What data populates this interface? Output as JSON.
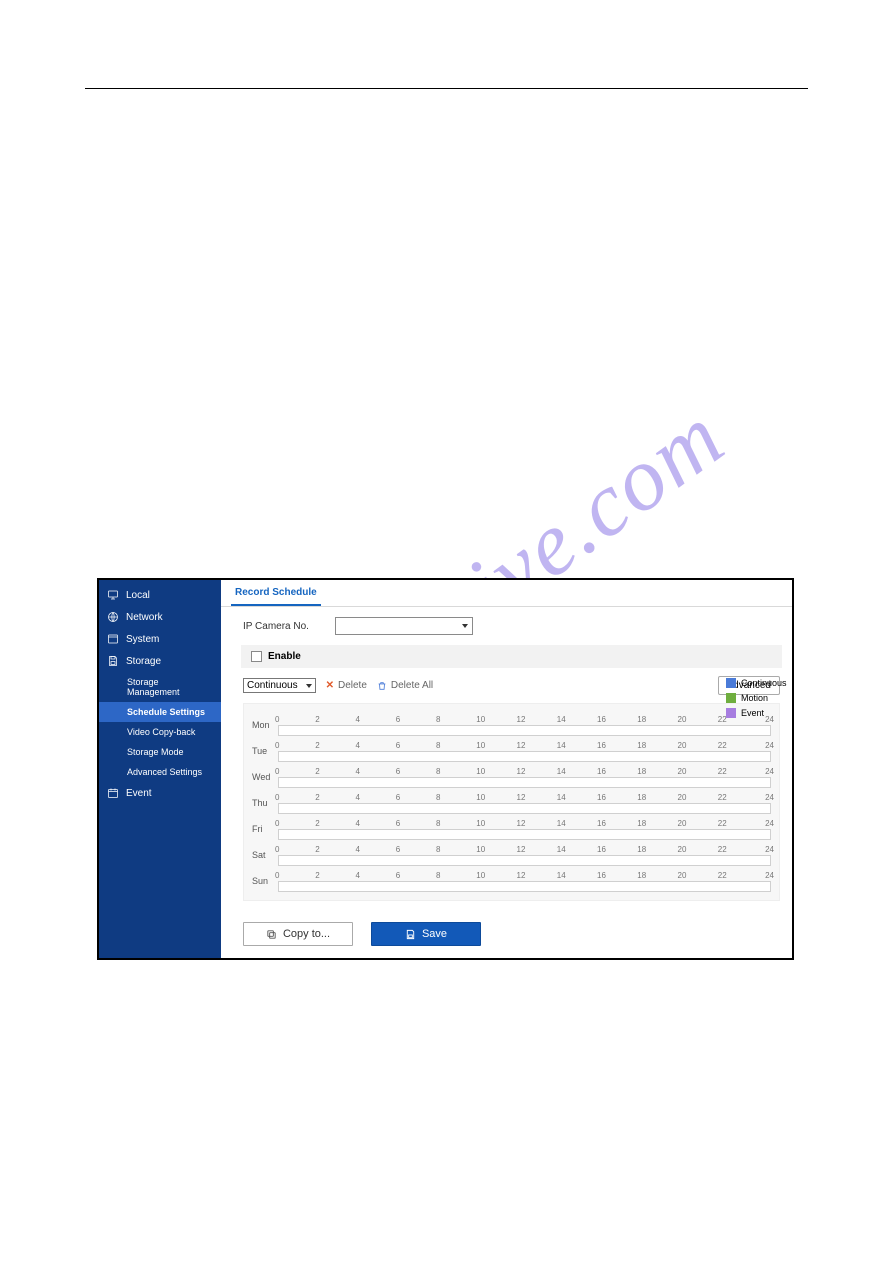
{
  "watermark": "manualshive.com",
  "sidebar": {
    "items": [
      {
        "label": "Local",
        "icon": "monitor"
      },
      {
        "label": "Network",
        "icon": "globe"
      },
      {
        "label": "System",
        "icon": "window"
      },
      {
        "label": "Storage",
        "icon": "save"
      },
      {
        "label": "Event",
        "icon": "calendar"
      }
    ],
    "storage_sub": [
      "Storage Management",
      "Schedule Settings",
      "Video Copy-back",
      "Storage Mode",
      "Advanced Settings"
    ],
    "active_sub_index": 1
  },
  "tabs": {
    "active": "Record Schedule"
  },
  "form": {
    "camera_label": "IP Camera No.",
    "camera_value": "",
    "enable_label": "Enable",
    "enable_checked": false
  },
  "toolbar": {
    "mode_value": "Continuous",
    "delete_label": "Delete",
    "delete_all_label": "Delete All",
    "advanced_label": "Advanced"
  },
  "schedule": {
    "days": [
      "Mon",
      "Tue",
      "Wed",
      "Thu",
      "Fri",
      "Sat",
      "Sun"
    ],
    "hours": [
      "0",
      "2",
      "4",
      "6",
      "8",
      "10",
      "12",
      "14",
      "16",
      "18",
      "20",
      "22",
      "24"
    ]
  },
  "legend": [
    {
      "label": "Continuous",
      "color": "#4a7bd8"
    },
    {
      "label": "Motion",
      "color": "#6fae3f"
    },
    {
      "label": "Event",
      "color": "#a77de0"
    }
  ],
  "footer": {
    "copy_label": "Copy to...",
    "save_label": "Save"
  }
}
